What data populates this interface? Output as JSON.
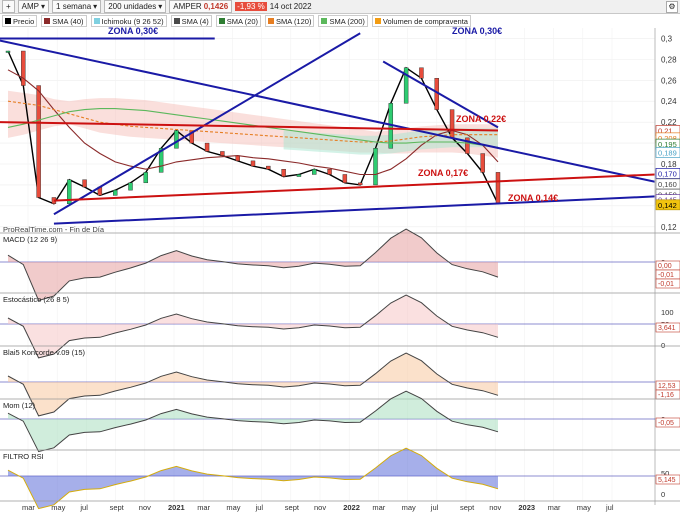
{
  "toolbar": {
    "symbol": "AMP",
    "period": "1 semana",
    "units": "200 unidades",
    "ticker": "AMPER",
    "price": "0,1426",
    "change": "-1,93 %",
    "date": "14 oct 2022"
  },
  "legend": [
    {
      "label": "Precio",
      "color": "#000000"
    },
    {
      "label": "SMA (40)",
      "color": "#8b2a2a"
    },
    {
      "label": "Ichimoku (9 26 52)",
      "color": "#7fd0e0"
    },
    {
      "label": "SMA (4)",
      "color": "#4a4a4a"
    },
    {
      "label": "SMA (20)",
      "color": "#2e7d32"
    },
    {
      "label": "SMA (120)",
      "color": "#e67e22"
    },
    {
      "label": "SMA (200)",
      "color": "#5cb85c"
    },
    {
      "label": "Volumen de compraventa",
      "color": "#f39c12"
    }
  ],
  "annotations": {
    "zona_030_left": "ZONA 0,30€",
    "zona_030_right": "ZONA 0,30€",
    "zona_022": "ZONA 0,22€",
    "zona_017": "ZONA 0,17€",
    "zona_014": "ZONA 0,14€",
    "source": "ProRealTime.com - Fin de Día"
  },
  "price_axis": {
    "ticks": [
      "0,3",
      "0,28",
      "0,26",
      "0,24",
      "0,22",
      "0,2",
      "0,18",
      "0,16",
      "0,14",
      "0,12"
    ],
    "tags": [
      {
        "text": "0,21",
        "bg": "#ffffff",
        "fg": "#c0392b",
        "border": "#c0392b",
        "v": 0.212
      },
      {
        "text": "0,208",
        "bg": "#ffffff",
        "fg": "#e67e22",
        "border": "#e67e22",
        "v": 0.205
      },
      {
        "text": "0,195",
        "bg": "#ffffff",
        "fg": "#2e7d32",
        "border": "#2e7d32",
        "v": 0.199
      },
      {
        "text": "0,189",
        "bg": "#ffffff",
        "fg": "#4aa3c6",
        "border": "#4aa3c6",
        "v": 0.191
      },
      {
        "text": "0,170",
        "bg": "#ffffff",
        "fg": "#1a1aa6",
        "border": "#1a1aa6",
        "v": 0.171
      },
      {
        "text": "0,160",
        "bg": "#ffffff",
        "fg": "#444444",
        "border": "#888888",
        "v": 0.161
      },
      {
        "text": "0,150",
        "bg": "#ffffff",
        "fg": "#444444",
        "border": "#888888",
        "v": 0.151
      },
      {
        "text": "0,145",
        "bg": "#ffffff",
        "fg": "#6b3fa0",
        "border": "#6b3fa0",
        "v": 0.146
      },
      {
        "text": "0,142",
        "bg": "#f1c40f",
        "fg": "#000000",
        "border": "#b7950b",
        "v": 0.141
      }
    ]
  },
  "panels": {
    "macd": {
      "label": "MACD (12 26 9)",
      "ticks": [
        "0"
      ],
      "tags": [
        "0,00",
        "-0,01",
        "-0,01"
      ]
    },
    "stoch": {
      "label": "Estocástico (26 8 5)",
      "ticks": [
        "100",
        "50",
        "0"
      ],
      "tags": [
        "3,641"
      ]
    },
    "blai": {
      "label": "Blai5 Koncorde v.09 (15)",
      "ticks": [],
      "tags": [
        "12,53",
        "-1,16"
      ]
    },
    "mom": {
      "label": "Mom (12)",
      "ticks": [
        "0"
      ],
      "tags": [
        "-0,05"
      ]
    },
    "rsi": {
      "label": "FILTRO RSI",
      "ticks": [
        "50",
        "0"
      ],
      "tags": [
        "5,145"
      ]
    }
  },
  "time_axis": [
    "mar",
    "may",
    "jul",
    "sept",
    "nov",
    "2021",
    "mar",
    "may",
    "jul",
    "sept",
    "nov",
    "2022",
    "mar",
    "may",
    "jul",
    "sept",
    "nov",
    "2023",
    "mar",
    "may",
    "jul"
  ],
  "chart_data": {
    "type": "line",
    "title": "",
    "xlabel": "",
    "ylabel": "",
    "ylim": [
      0.115,
      0.31
    ],
    "grid": true,
    "x": [
      "2020-02",
      "2020-03",
      "2020-04",
      "2020-05",
      "2020-06",
      "2020-07",
      "2020-08",
      "2020-09",
      "2020-10",
      "2020-11",
      "2020-12",
      "2021-01",
      "2021-02",
      "2021-03",
      "2021-04",
      "2021-05",
      "2021-06",
      "2021-07",
      "2021-08",
      "2021-09",
      "2021-10",
      "2021-11",
      "2021-12",
      "2022-01",
      "2022-02",
      "2022-03",
      "2022-04",
      "2022-05",
      "2022-06",
      "2022-07",
      "2022-08",
      "2022-09",
      "2022-10"
    ],
    "series": [
      {
        "values": [
          0.288,
          0.255,
          0.148,
          0.142,
          0.165,
          0.158,
          0.15,
          0.155,
          0.162,
          0.172,
          0.195,
          0.212,
          0.2,
          0.192,
          0.188,
          0.183,
          0.178,
          0.175,
          0.168,
          0.17,
          0.175,
          0.17,
          0.162,
          0.16,
          0.195,
          0.238,
          0.272,
          0.262,
          0.232,
          0.205,
          0.19,
          0.172,
          0.142
        ],
        "color": "#000000"
      },
      {
        "values": [
          0.27,
          0.262,
          0.25,
          0.232,
          0.215,
          0.2,
          0.19,
          0.182,
          0.178,
          0.175,
          0.178,
          0.182,
          0.184,
          0.186,
          0.187,
          0.188,
          0.186,
          0.185,
          0.183,
          0.181,
          0.178,
          0.176,
          0.173,
          0.17,
          0.17,
          0.175,
          0.185,
          0.198,
          0.208,
          0.212,
          0.208,
          0.198,
          0.182
        ],
        "color": "#8b2a2a"
      },
      {
        "values": [
          0.24,
          0.238,
          0.236,
          0.232,
          0.228,
          0.224,
          0.22,
          0.218,
          0.216,
          0.215,
          0.214,
          0.213,
          0.212,
          0.211,
          0.21,
          0.209,
          0.208,
          0.207,
          0.206,
          0.205,
          0.204,
          0.203,
          0.202,
          0.201,
          0.201,
          0.202,
          0.204,
          0.206,
          0.207,
          0.208,
          0.208,
          0.208,
          0.208
        ],
        "color": "#e67e22"
      },
      {
        "values": [
          0.215,
          0.218,
          0.222,
          0.226,
          0.23,
          0.232,
          0.233,
          0.233,
          0.232,
          0.231,
          0.229,
          0.227,
          0.225,
          0.223,
          0.221,
          0.219,
          0.217,
          0.215,
          0.213,
          0.211,
          0.209,
          0.207,
          0.205,
          0.203,
          0.201,
          0.2,
          0.2,
          0.201,
          0.201,
          0.201,
          0.2,
          0.198,
          0.196
        ],
        "color": "#5cb85c"
      }
    ],
    "trendlines": [
      {
        "name": "resistencia",
        "color": "#1a1aa6",
        "points": [
          [
            0,
            0.298
          ],
          [
            33,
            0.163
          ]
        ]
      },
      {
        "name": "soporte",
        "color": "#1a1aa6",
        "points": [
          [
            3,
            0.123
          ],
          [
            33,
            0.149
          ]
        ]
      },
      {
        "name": "alcista",
        "color": "#1a1aa6",
        "points": [
          [
            3,
            0.132
          ],
          [
            23,
            0.305
          ]
        ]
      },
      {
        "name": "bajista",
        "color": "#1a1aa6",
        "points": [
          [
            24.5,
            0.278
          ],
          [
            32,
            0.215
          ]
        ]
      },
      {
        "name": "zona022",
        "color": "#cc1111",
        "points": [
          [
            0,
            0.22
          ],
          [
            32,
            0.212
          ]
        ]
      },
      {
        "name": "zona017",
        "color": "#cc1111",
        "points": [
          [
            3,
            0.145
          ],
          [
            33,
            0.17
          ]
        ]
      },
      {
        "name": "zona030",
        "color": "#1a1aa6",
        "points": [
          [
            0,
            0.3
          ],
          [
            13.5,
            0.3
          ]
        ]
      }
    ]
  }
}
